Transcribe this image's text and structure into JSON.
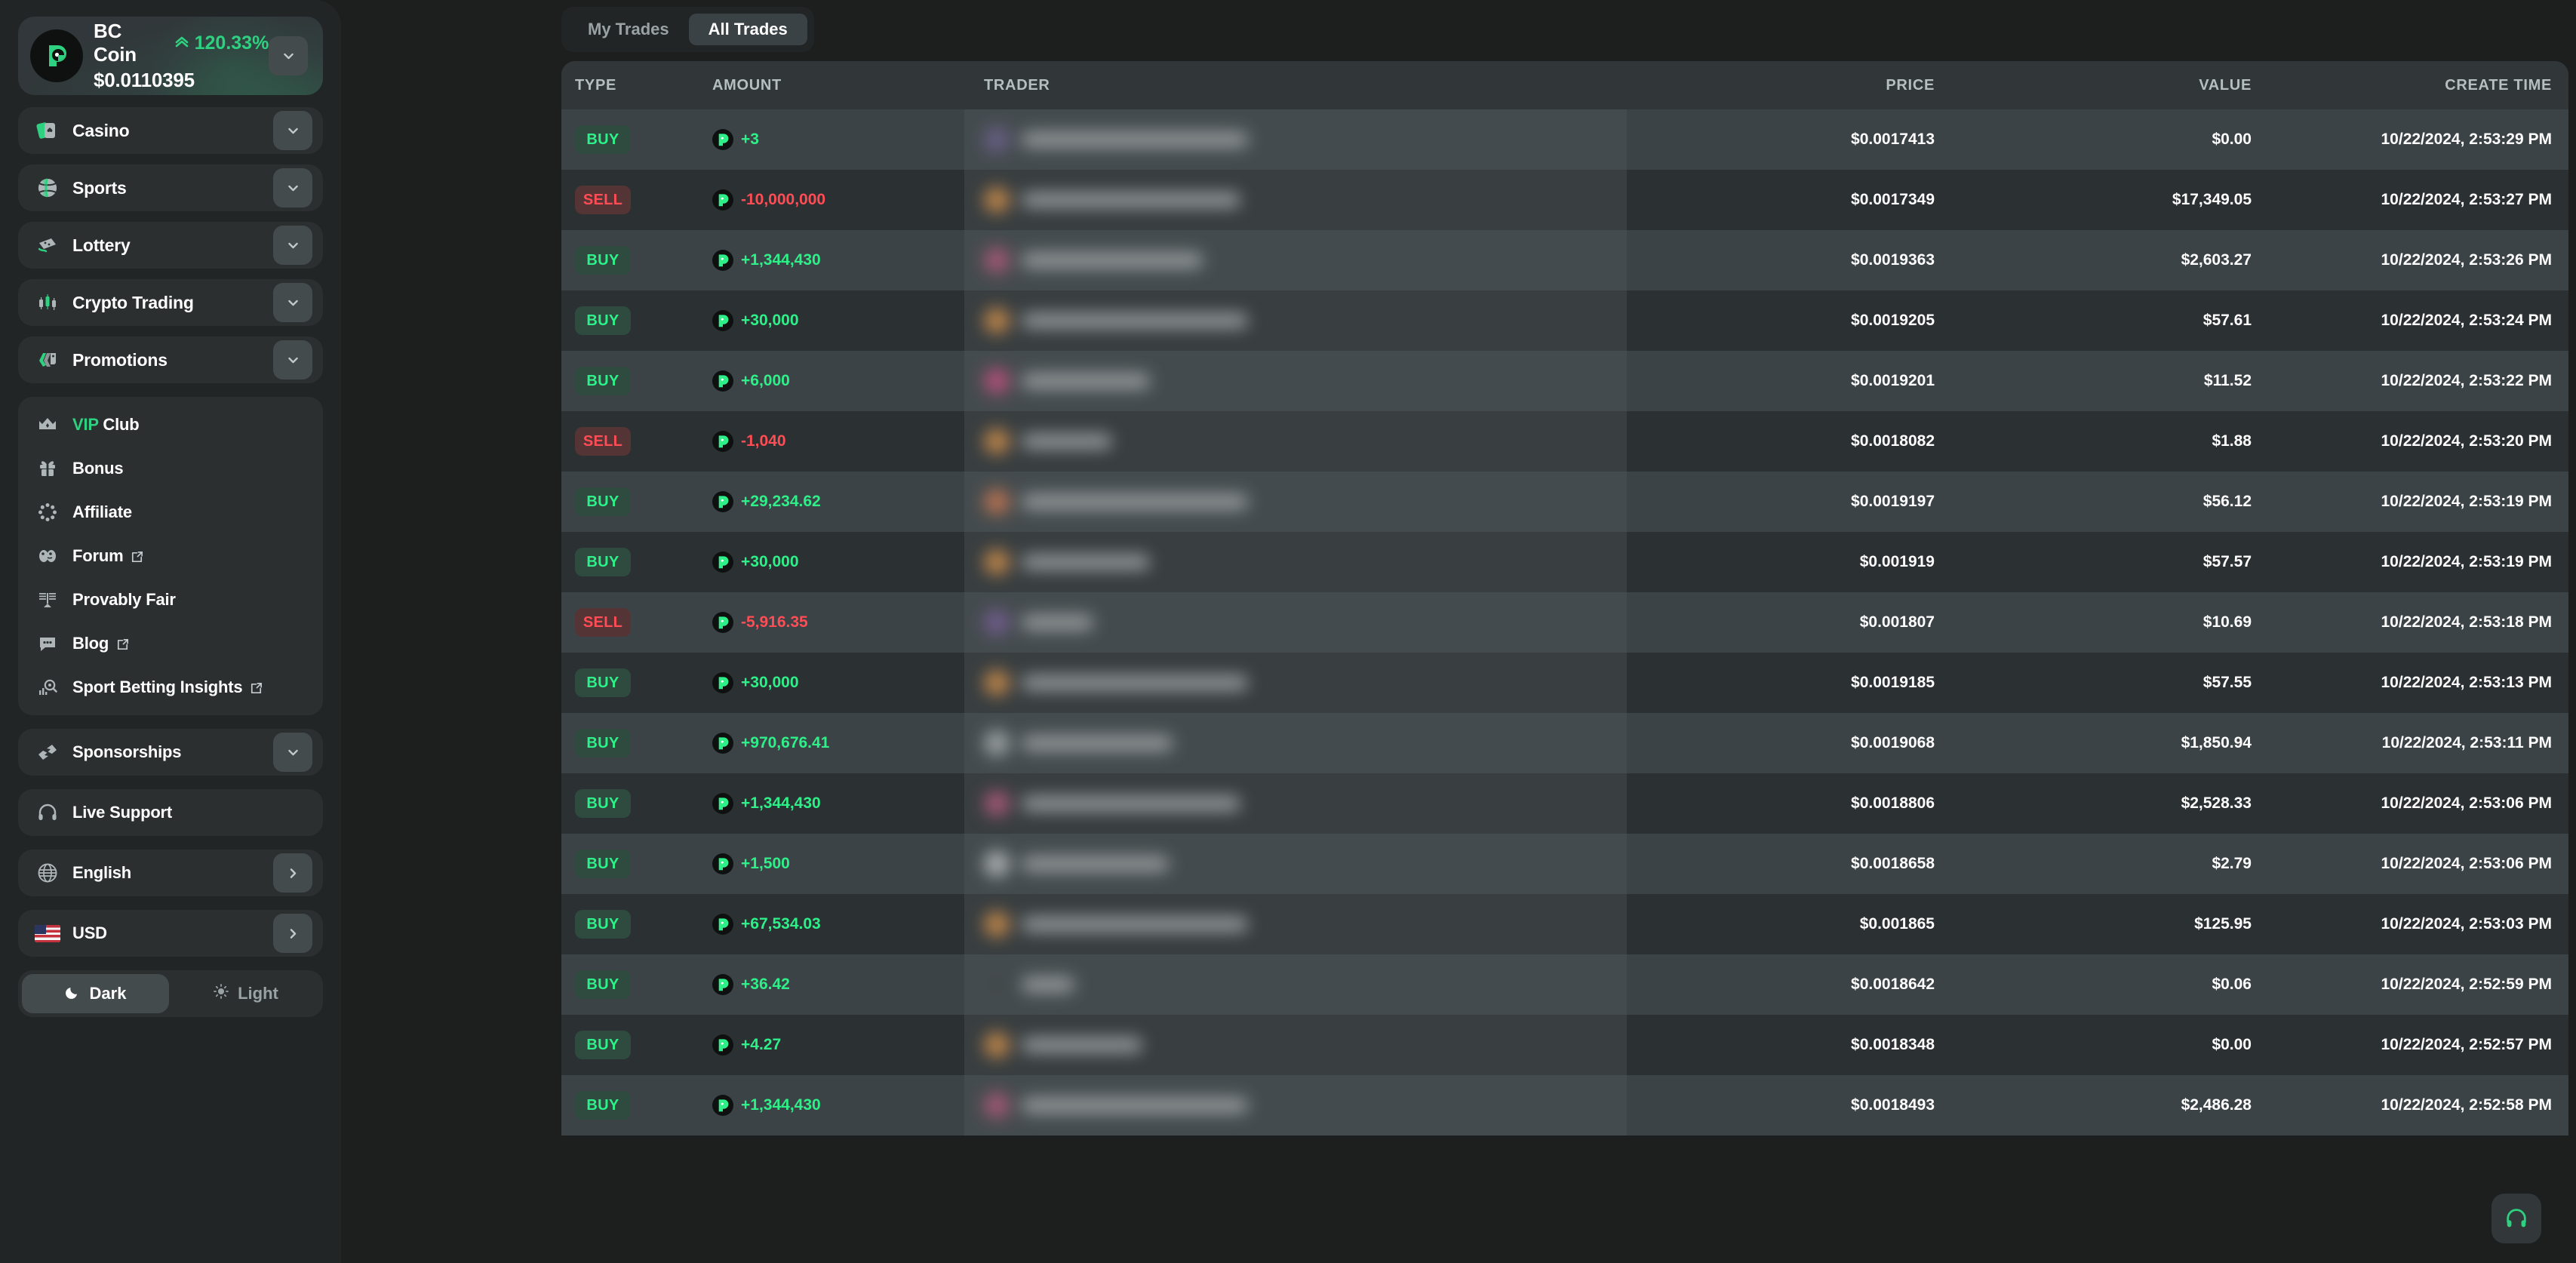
{
  "colors": {
    "accent_green": "#2ed180",
    "bright_green": "#2ef089",
    "sell_red": "#ff4d55",
    "sidebar_bg": "#222525",
    "page_bg": "#1d1f1f",
    "row_odd": "#3c4346",
    "row_even": "#2b3032",
    "header_row": "#313638"
  },
  "sidebar": {
    "coin": {
      "name": "BC Coin",
      "change_pct": "120.33%",
      "price": "$0.0110395",
      "logo_icon": "bc-coin-logo-icon",
      "expand_icon": "chevron-down-icon"
    },
    "nav_groups": [
      {
        "label": "Casino",
        "icon": "casino-cards-icon",
        "chevron": "chevron-down-icon"
      },
      {
        "label": "Sports",
        "icon": "basketball-icon",
        "chevron": "chevron-down-icon"
      },
      {
        "label": "Lottery",
        "icon": "lottery-ticket-icon",
        "chevron": "chevron-down-icon"
      },
      {
        "label": "Crypto Trading",
        "icon": "candlestick-icon",
        "chevron": "chevron-down-icon"
      },
      {
        "label": "Promotions",
        "icon": "price-tags-icon",
        "chevron": "chevron-down-icon"
      }
    ],
    "links": [
      {
        "label": "VIP Club",
        "accent_prefix": "VIP",
        "rest": " Club",
        "icon": "crown-icon",
        "external": false
      },
      {
        "label": "Bonus",
        "icon": "gift-icon",
        "external": false
      },
      {
        "label": "Affiliate",
        "icon": "affiliate-icon",
        "external": false
      },
      {
        "label": "Forum",
        "icon": "forum-faces-icon",
        "external": true
      },
      {
        "label": "Provably Fair",
        "icon": "provably-fair-icon",
        "external": false
      },
      {
        "label": "Blog",
        "icon": "chat-bubble-icon",
        "external": true
      },
      {
        "label": "Sport Betting Insights",
        "icon": "insights-search-icon",
        "external": true
      }
    ],
    "sponsorships": {
      "label": "Sponsorships",
      "icon": "handshake-icon",
      "chevron": "chevron-down-icon"
    },
    "live_support": {
      "label": "Live Support",
      "icon": "headphones-icon"
    },
    "language": {
      "label": "English",
      "icon": "globe-icon",
      "chevron": "chevron-right-icon"
    },
    "currency": {
      "label": "USD",
      "icon": "us-flag-icon",
      "chevron": "chevron-right-icon"
    },
    "theme": {
      "dark_label": "Dark",
      "light_label": "Light",
      "dark_icon": "moon-icon",
      "light_icon": "sun-icon",
      "active": "Dark"
    }
  },
  "main": {
    "tabs": [
      {
        "label": "My Trades",
        "active": false
      },
      {
        "label": "All Trades",
        "active": true
      }
    ],
    "support_fab_icon": "headphones-icon",
    "table": {
      "columns": [
        "TYPE",
        "AMOUNT",
        "TRADER",
        "PRICE",
        "VALUE",
        "CREATE TIME"
      ],
      "trader_obscured": true,
      "rows": [
        {
          "type": "BUY",
          "amount": "+3",
          "price": "$0.0017413",
          "value": "$0.00",
          "time": "10/22/2024, 2:53:29 PM",
          "avatar_color": "#6c5f93"
        },
        {
          "type": "SELL",
          "amount": "-10,000,000",
          "price": "$0.0017349",
          "value": "$17,349.05",
          "time": "10/22/2024, 2:53:27 PM",
          "avatar_color": "#e8953f"
        },
        {
          "type": "BUY",
          "amount": "+1,344,430",
          "price": "$0.0019363",
          "value": "$2,603.27",
          "time": "10/22/2024, 2:53:26 PM",
          "avatar_color": "#c2557a"
        },
        {
          "type": "BUY",
          "amount": "+30,000",
          "price": "$0.0019205",
          "value": "$57.61",
          "time": "10/22/2024, 2:53:24 PM",
          "avatar_color": "#e8953f"
        },
        {
          "type": "BUY",
          "amount": "+6,000",
          "price": "$0.0019201",
          "value": "$11.52",
          "time": "10/22/2024, 2:53:22 PM",
          "avatar_color": "#d84a83"
        },
        {
          "type": "SELL",
          "amount": "-1,040",
          "price": "$0.0018082",
          "value": "$1.88",
          "time": "10/22/2024, 2:53:20 PM",
          "avatar_color": "#e8953f"
        },
        {
          "type": "BUY",
          "amount": "+29,234.62",
          "price": "$0.0019197",
          "value": "$56.12",
          "time": "10/22/2024, 2:53:19 PM",
          "avatar_color": "#e07a4a"
        },
        {
          "type": "BUY",
          "amount": "+30,000",
          "price": "$0.001919",
          "value": "$57.57",
          "time": "10/22/2024, 2:53:19 PM",
          "avatar_color": "#e8953f"
        },
        {
          "type": "SELL",
          "amount": "-5,916.35",
          "price": "$0.001807",
          "value": "$10.69",
          "time": "10/22/2024, 2:53:18 PM",
          "avatar_color": "#7a5b9e"
        },
        {
          "type": "BUY",
          "amount": "+30,000",
          "price": "$0.0019185",
          "value": "$57.55",
          "time": "10/22/2024, 2:53:13 PM",
          "avatar_color": "#e8953f"
        },
        {
          "type": "BUY",
          "amount": "+970,676.41",
          "price": "$0.0019068",
          "value": "$1,850.94",
          "time": "10/22/2024, 2:53:11 PM",
          "avatar_color": "#b9bfc0"
        },
        {
          "type": "BUY",
          "amount": "+1,344,430",
          "price": "$0.0018806",
          "value": "$2,528.33",
          "time": "10/22/2024, 2:53:06 PM",
          "avatar_color": "#c2557a"
        },
        {
          "type": "BUY",
          "amount": "+1,500",
          "price": "$0.0018658",
          "value": "$2.79",
          "time": "10/22/2024, 2:53:06 PM",
          "avatar_color": "#cfd4d5"
        },
        {
          "type": "BUY",
          "amount": "+67,534.03",
          "price": "$0.001865",
          "value": "$125.95",
          "time": "10/22/2024, 2:53:03 PM",
          "avatar_color": "#e8953f"
        },
        {
          "type": "BUY",
          "amount": "+36.42",
          "price": "$0.0018642",
          "value": "$0.06",
          "time": "10/22/2024, 2:52:59 PM",
          "avatar_color": "#3a4042"
        },
        {
          "type": "BUY",
          "amount": "+4.27",
          "price": "$0.0018348",
          "value": "$0.00",
          "time": "10/22/2024, 2:52:57 PM",
          "avatar_color": "#e8953f"
        },
        {
          "type": "BUY",
          "amount": "+1,344,430",
          "price": "$0.0018493",
          "value": "$2,486.28",
          "time": "10/22/2024, 2:52:58 PM",
          "avatar_color": "#c2557a"
        }
      ]
    }
  }
}
